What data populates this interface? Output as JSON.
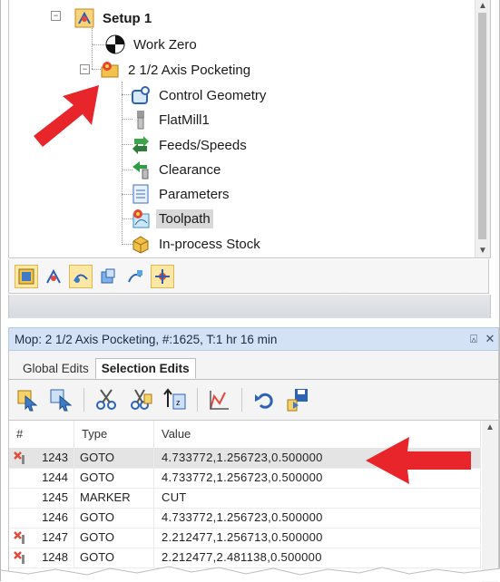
{
  "tree": {
    "nodes": [
      {
        "label": "Setup 1",
        "icon": "setup-icon"
      },
      {
        "label": "Work Zero",
        "icon": "work-zero-icon"
      },
      {
        "label": "2 1/2 Axis Pocketing",
        "icon": "pocketing-folder-icon"
      },
      {
        "label": "Control Geometry",
        "icon": "control-geometry-icon"
      },
      {
        "label": "FlatMill1",
        "icon": "flatmill-tool-icon"
      },
      {
        "label": "Feeds/Speeds",
        "icon": "feeds-speeds-icon"
      },
      {
        "label": "Clearance",
        "icon": "clearance-icon"
      },
      {
        "label": "Parameters",
        "icon": "parameters-icon"
      },
      {
        "label": "Toolpath",
        "icon": "toolpath-icon"
      },
      {
        "label": "In-process Stock",
        "icon": "in-process-stock-icon"
      }
    ]
  },
  "panel": {
    "title": "Mop: 2 1/2 Axis Pocketing, #:1625, T:1 hr 16 min",
    "pin": "⍓",
    "close": "✕",
    "tabs": [
      "Global Edits",
      "Selection Edits"
    ]
  },
  "grid": {
    "headers": [
      "#",
      "Type",
      "Value"
    ],
    "rows": [
      {
        "num": "1243",
        "type": "GOTO",
        "value": "4.733772,1.256723,0.500000"
      },
      {
        "num": "1244",
        "type": "GOTO",
        "value": "4.733772,1.256723,0.500000"
      },
      {
        "num": "1245",
        "type": "MARKER",
        "value": "CUT"
      },
      {
        "num": "1246",
        "type": "GOTO",
        "value": "4.733772,1.256723,0.500000"
      },
      {
        "num": "1247",
        "type": "GOTO",
        "value": "2.212477,1.256713,0.500000"
      },
      {
        "num": "1248",
        "type": "GOTO",
        "value": "2.212477,2.481138,0.500000"
      }
    ]
  },
  "colors": {
    "arrow": "#e8252b",
    "panel_header": "#d3e2f4",
    "active_mode_button": "#fbe8a6"
  }
}
